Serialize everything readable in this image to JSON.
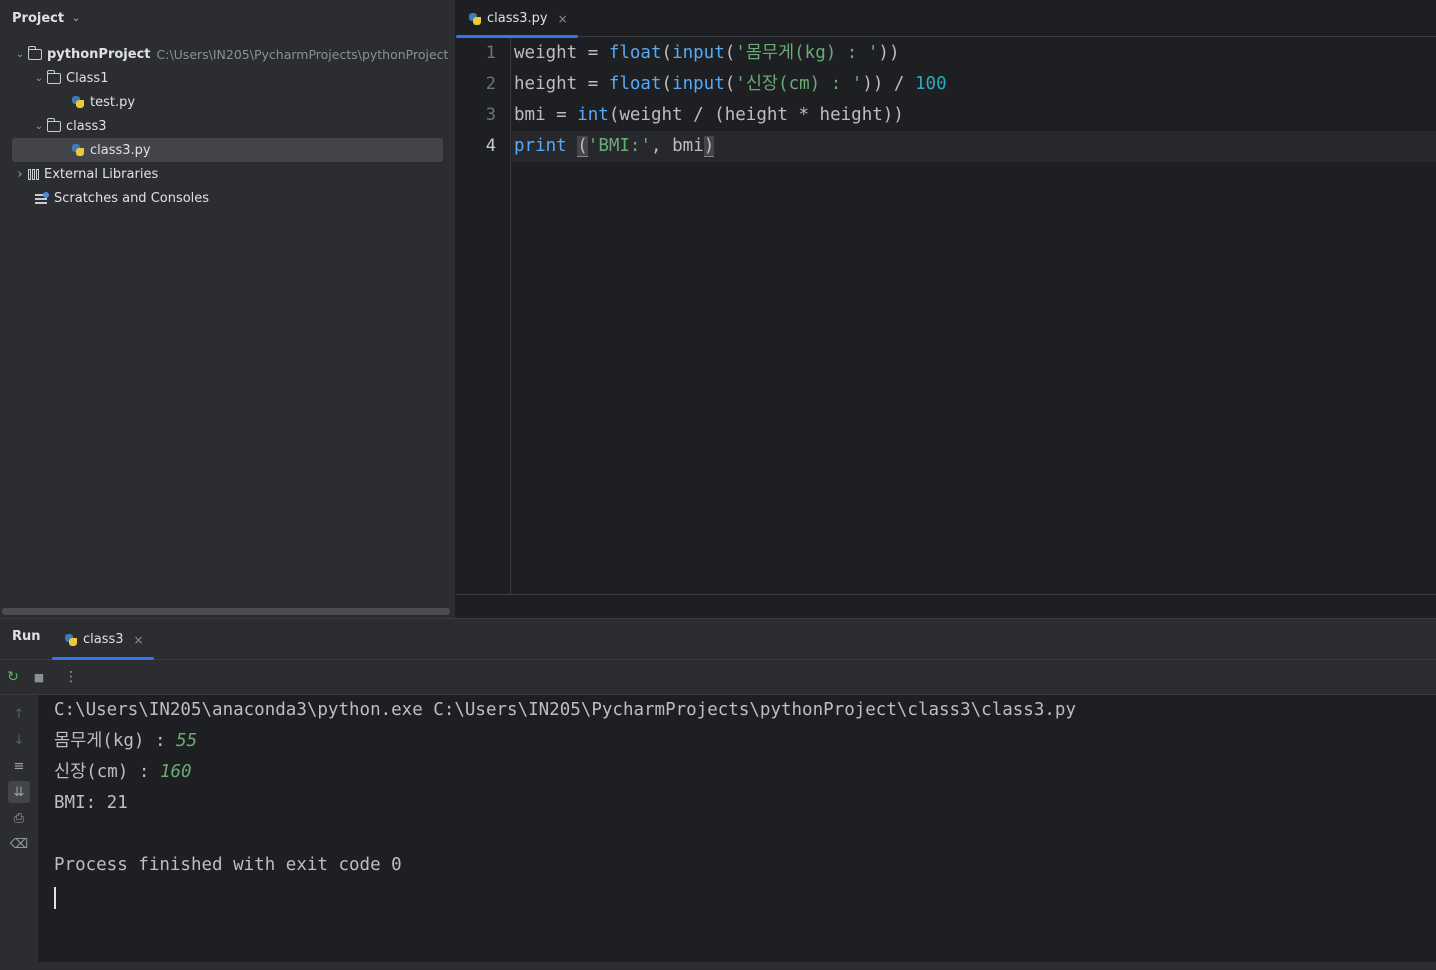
{
  "project_panel": {
    "title": "Project",
    "tree": {
      "root_name": "pythonProject",
      "root_path": "C:\\Users\\IN205\\PycharmProjects\\pythonProject",
      "folder1": "Class1",
      "file1": "test.py",
      "folder2": "class3",
      "file2": "class3.py",
      "external": "External Libraries",
      "scratches": "Scratches and Consoles"
    }
  },
  "editor": {
    "tab_label": "class3.py",
    "line_numbers": [
      "1",
      "2",
      "3",
      "4"
    ],
    "lines": {
      "l1": {
        "a": "weight",
        "b": " = ",
        "c": "float",
        "d": "(",
        "e": "input",
        "f": "(",
        "g": "'몸무게(kg) : '",
        "h": "))"
      },
      "l2": {
        "a": "height",
        "b": " = ",
        "c": "float",
        "d": "(",
        "e": "input",
        "f": "(",
        "g": "'신장(cm) : '",
        "h": ")) / ",
        "i": "100"
      },
      "l3": {
        "a": "bmi",
        "b": " = ",
        "c": "int",
        "d": "(weight / (height * height))"
      },
      "l4": {
        "a": "print",
        "b": " ",
        "c": "(",
        "d": "'BMI:'",
        "e": ", bmi",
        "f": ")"
      }
    }
  },
  "run_panel": {
    "label": "Run",
    "tab_label": "class3",
    "console": {
      "cmd": "C:\\Users\\IN205\\anaconda3\\python.exe C:\\Users\\IN205\\PycharmProjects\\pythonProject\\class3\\class3.py",
      "prompt1": "몸무게(kg) : ",
      "input1": "55",
      "prompt2": "신장(cm) : ",
      "input2": "160",
      "result": "BMI: 21",
      "finish": "Process finished with exit code 0"
    }
  },
  "icons": {
    "chevron_down": "⌄",
    "chevron_right": "›",
    "close": "×",
    "rerun": "↻",
    "stop": "■",
    "more": "⋮",
    "up": "↑",
    "down": "↓",
    "wrap": "≡",
    "print": "⎙",
    "trash": "🗑"
  }
}
